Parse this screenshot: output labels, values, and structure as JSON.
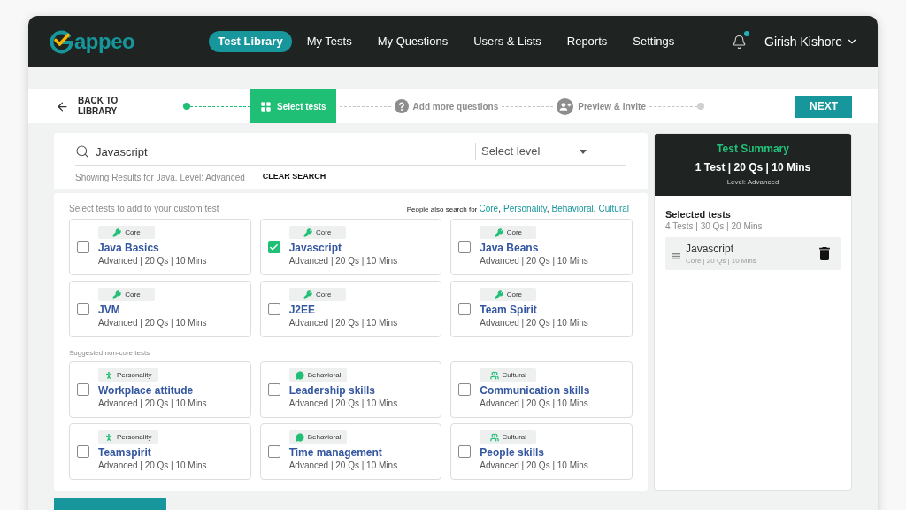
{
  "header": {
    "logo": "appeo",
    "nav": [
      {
        "label": "Test Library",
        "selected": true
      },
      {
        "label": "My Tests",
        "selected": false
      },
      {
        "label": "My Questions",
        "selected": false
      },
      {
        "label": "Users & Lists",
        "selected": false
      },
      {
        "label": "Reports",
        "selected": false
      },
      {
        "label": "Settings",
        "selected": false
      }
    ],
    "notifications": {
      "unread": true
    },
    "user": {
      "name": "Girish Kishore"
    }
  },
  "stepbar": {
    "back": "BACK TO LIBRARY",
    "steps": [
      {
        "kind": "select",
        "label": "Select tests",
        "selected": true
      },
      {
        "kind": "questions",
        "label": "Add more questions",
        "selected": false
      },
      {
        "kind": "invite",
        "label": "Preview & Invite",
        "selected": false
      }
    ],
    "next": "NEXT"
  },
  "search": {
    "value": "Javascript",
    "level_select": {
      "placeholder": "Select level"
    },
    "results_note": "Showing Results for Java. Level: Advanced",
    "clear": "CLEAR SEARCH"
  },
  "tests": {
    "hint": "Select tests to add to your custom test",
    "related": {
      "label": "People also search for",
      "separator": ",",
      "links": [
        "Core",
        "Personality",
        "Behavioral",
        "Cultural"
      ]
    },
    "sections": [
      {
        "cards": [
          {
            "tag": {
              "kind": "core",
              "label": "Core"
            },
            "title": "Java Basics",
            "meta": "Advanced | 20 Qs | 10 Mins",
            "checked": false
          },
          {
            "tag": {
              "kind": "core",
              "label": "Core"
            },
            "title": "Javascript",
            "meta": "Advanced | 20 Qs | 10 Mins",
            "checked": true
          },
          {
            "tag": {
              "kind": "core",
              "label": "Core"
            },
            "title": "Java Beans",
            "meta": "Advanced | 20 Qs | 10 Mins",
            "checked": false
          },
          {
            "tag": {
              "kind": "core",
              "label": "Core"
            },
            "title": "JVM",
            "meta": "Advanced | 20 Qs | 10 Mins",
            "checked": false
          },
          {
            "tag": {
              "kind": "core",
              "label": "Core"
            },
            "title": "J2EE",
            "meta": "Advanced | 20 Qs | 10 Mins",
            "checked": false
          },
          {
            "tag": {
              "kind": "core",
              "label": "Core"
            },
            "title": "Team Spirit",
            "meta": "Advanced | 20 Qs | 10 Mins",
            "checked": false
          }
        ]
      },
      {
        "title": "Suggested non-core tests",
        "cards": [
          {
            "tag": {
              "kind": "personality",
              "label": "Personality"
            },
            "title": "Workplace attitude",
            "meta": "Advanced | 20 Qs | 10 Mins",
            "checked": false
          },
          {
            "tag": {
              "kind": "behavioral",
              "label": "Behavioral"
            },
            "title": "Leadership skills",
            "meta": "Advanced | 20 Qs | 10 Mins",
            "checked": false
          },
          {
            "tag": {
              "kind": "cultural",
              "label": "Cultural"
            },
            "title": "Communication skills",
            "meta": "Advanced | 20 Qs | 10 Mins",
            "checked": false
          },
          {
            "tag": {
              "kind": "personality",
              "label": "Personality"
            },
            "title": "Teamspirit",
            "meta": "Advanced | 20 Qs | 10 Mins",
            "checked": false
          },
          {
            "tag": {
              "kind": "behavioral",
              "label": "Behavioral"
            },
            "title": "Time management",
            "meta": "Advanced | 20 Qs | 10 Mins",
            "checked": false
          },
          {
            "tag": {
              "kind": "cultural",
              "label": "Cultural"
            },
            "title": "People skills",
            "meta": "Advanced | 20 Qs | 10 Mins",
            "checked": false
          }
        ]
      }
    ]
  },
  "summary": {
    "title": "Test Summary",
    "totals": "1 Test | 20 Qs | 10 Mins",
    "level": "Level: Advanced",
    "selected_title": "Selected tests",
    "selected_totals": "4 Tests | 30 Qs | 20 Mins",
    "items": [
      {
        "name": "Javascript",
        "meta": "Core | 20 Qs | 10 Mins"
      }
    ]
  }
}
